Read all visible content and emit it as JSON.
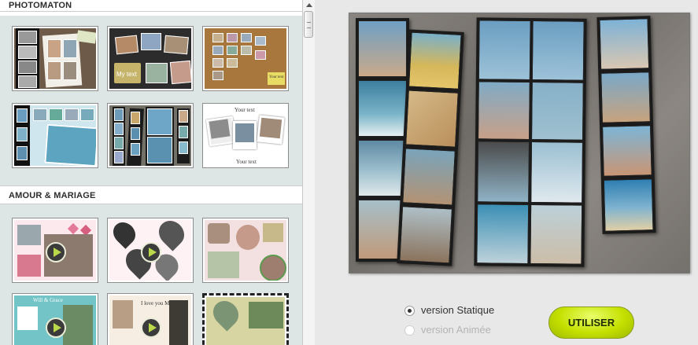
{
  "sections": {
    "photomaton": {
      "title": "PHOTOMATON"
    },
    "amour": {
      "title": "AMOUR & MARIAGE"
    }
  },
  "thumbnails": {
    "t2_text": "My text",
    "t3_text": "Your text",
    "t6_top": "Your text",
    "t6_bottom": "Your text",
    "t11_text": "I love you Mom!",
    "t10_text": "Will & Grace"
  },
  "options": {
    "static_label": "version Statique",
    "animated_label": "version Animée",
    "selected": "static"
  },
  "use_button": {
    "label": "UTILISER"
  },
  "colors": {
    "accent": "#c4e000",
    "panel": "#dee5e5"
  }
}
